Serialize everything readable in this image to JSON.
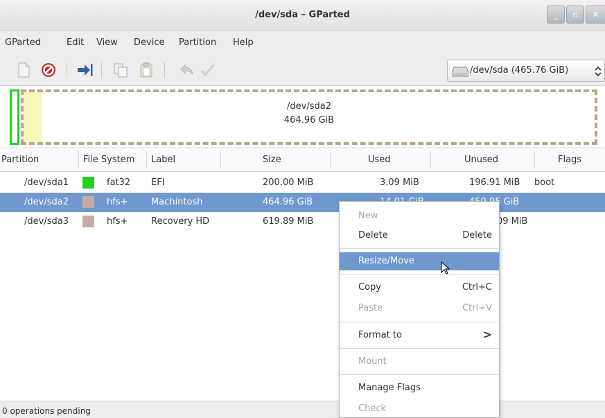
{
  "window": {
    "title": "/dev/sda – GParted"
  },
  "menubar": {
    "items": [
      {
        "label": "GParted"
      },
      {
        "label": "Edit"
      },
      {
        "label": "View"
      },
      {
        "label": "Device"
      },
      {
        "label": "Partition"
      },
      {
        "label": "Help"
      }
    ]
  },
  "toolbar": {
    "icons": [
      "new-icon",
      "delete-icon",
      "resize-move-icon",
      "copy-icon",
      "paste-icon",
      "undo-icon",
      "apply-icon"
    ],
    "device_selector": {
      "label": "/dev/sda  (465.76 GiB)",
      "icon": "harddisk-icon"
    }
  },
  "disk_graphic": {
    "partition_name": "/dev/sda2",
    "partition_size": "464.96 GiB"
  },
  "table": {
    "columns": [
      "Partition",
      "File System",
      "Label",
      "Size",
      "Used",
      "Unused",
      "Flags"
    ],
    "rows": [
      {
        "partition": "/dev/sda1",
        "fs_color": "#1fd31f",
        "filesystem": "fat32",
        "label": "EFI",
        "size": "200.00 MiB",
        "used": "3.09 MiB",
        "unused": "196.91 MiB",
        "flags": "boot",
        "selected": false
      },
      {
        "partition": "/dev/sda2",
        "fs_color": "#c7aaa2",
        "filesystem": "hfs+",
        "label": "Machintosh",
        "size": "464.96 GiB",
        "used": "14.01 GiB",
        "unused": "450.95 GiB",
        "flags": "",
        "selected": true
      },
      {
        "partition": "/dev/sda3",
        "fs_color": "#c7aaa2",
        "filesystem": "hfs+",
        "label": "Recovery HD",
        "size": "619.89 MiB",
        "used": "",
        "unused": "09 MiB",
        "flags": "",
        "selected": false
      }
    ]
  },
  "context_menu": {
    "items": [
      {
        "label": "New",
        "accel": "",
        "disabled": true
      },
      {
        "label": "Delete",
        "accel": "Delete",
        "disabled": false
      },
      {
        "label": "Resize/Move",
        "accel": "",
        "disabled": false,
        "highlighted": true
      },
      {
        "label": "Copy",
        "accel": "Ctrl+C",
        "disabled": false
      },
      {
        "label": "Paste",
        "accel": "Ctrl+V",
        "disabled": true
      },
      {
        "label": "Format to",
        "accel": ">",
        "disabled": false
      },
      {
        "label": "Mount",
        "accel": "",
        "disabled": true
      },
      {
        "label": "Manage Flags",
        "accel": "",
        "disabled": false
      },
      {
        "label": "Check",
        "accel": "",
        "disabled": true
      }
    ]
  },
  "status": {
    "text": "0 operations pending"
  },
  "colors": {
    "selection": "#6f98cf",
    "fat32": "#1fd31f",
    "hfs": "#c7aaa2",
    "partition_border": "#b9a58a",
    "used_space": "#f7f7b8"
  }
}
